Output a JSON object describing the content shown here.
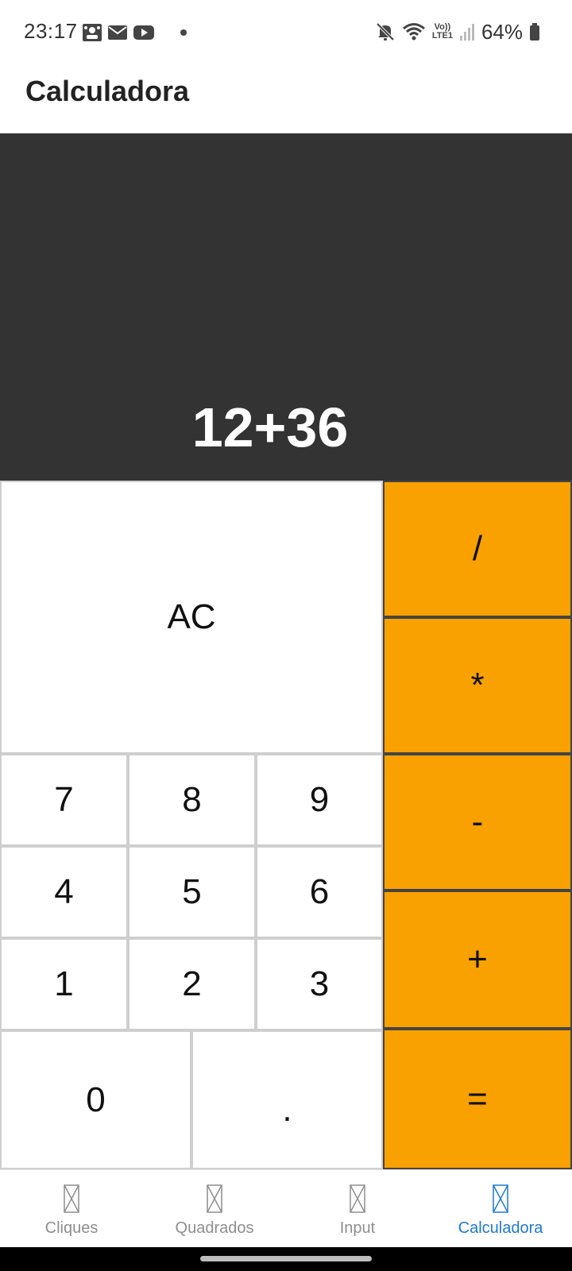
{
  "status_bar": {
    "time": "23:17",
    "battery_percent": "64%",
    "network_label_top": "Vo))",
    "network_label_bottom": "LTE1",
    "icons_left": [
      "people-icon",
      "mail-icon",
      "youtube-icon",
      "dot-icon"
    ],
    "icons_right": [
      "mute-icon",
      "wifi-icon",
      "volte-icon",
      "signal-icon",
      "battery-icon"
    ]
  },
  "app_bar": {
    "title": "Calculadora"
  },
  "display": {
    "expression": "12+36"
  },
  "keys": {
    "clear": "AC",
    "divide": "/",
    "multiply": "*",
    "subtract": "-",
    "add": "+",
    "equals": "=",
    "seven": "7",
    "eight": "8",
    "nine": "9",
    "four": "4",
    "five": "5",
    "six": "6",
    "one": "1",
    "two": "2",
    "three": "3",
    "zero": "0",
    "decimal": "."
  },
  "bottom_nav": {
    "items": [
      {
        "label": "Cliques",
        "active": false
      },
      {
        "label": "Quadrados",
        "active": false
      },
      {
        "label": "Input",
        "active": false
      },
      {
        "label": "Calculadora",
        "active": true
      }
    ]
  },
  "colors": {
    "display_bg": "#333333",
    "operator_bg": "#f9a100",
    "active_tab": "#1f7ad1",
    "inactive_tab": "#8e8e8e"
  }
}
